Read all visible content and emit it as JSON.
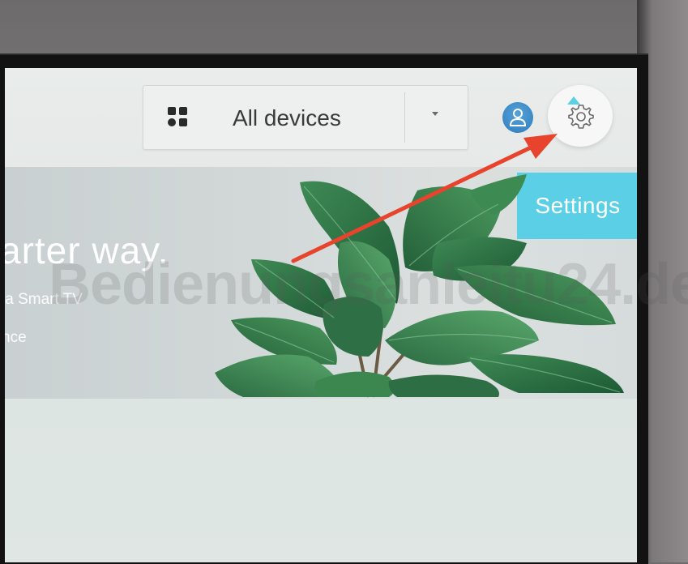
{
  "device_selector": {
    "label": "All devices",
    "icon": "grid-icon",
    "dropdown_icon": "caret-down-icon"
  },
  "header": {
    "account_icon": "account-icon",
    "settings_icon": "gear-icon"
  },
  "tooltip": {
    "text": "Settings"
  },
  "banner": {
    "title": "arter way.",
    "subtitle": "ia Smart TV",
    "subtitle2": "nce"
  },
  "watermark": {
    "text": "Bedienungsanleitu24.de"
  },
  "colors": {
    "tooltip": "#5bcfe6",
    "arrow": "#e8432c",
    "avatar": "#3a88c8"
  }
}
